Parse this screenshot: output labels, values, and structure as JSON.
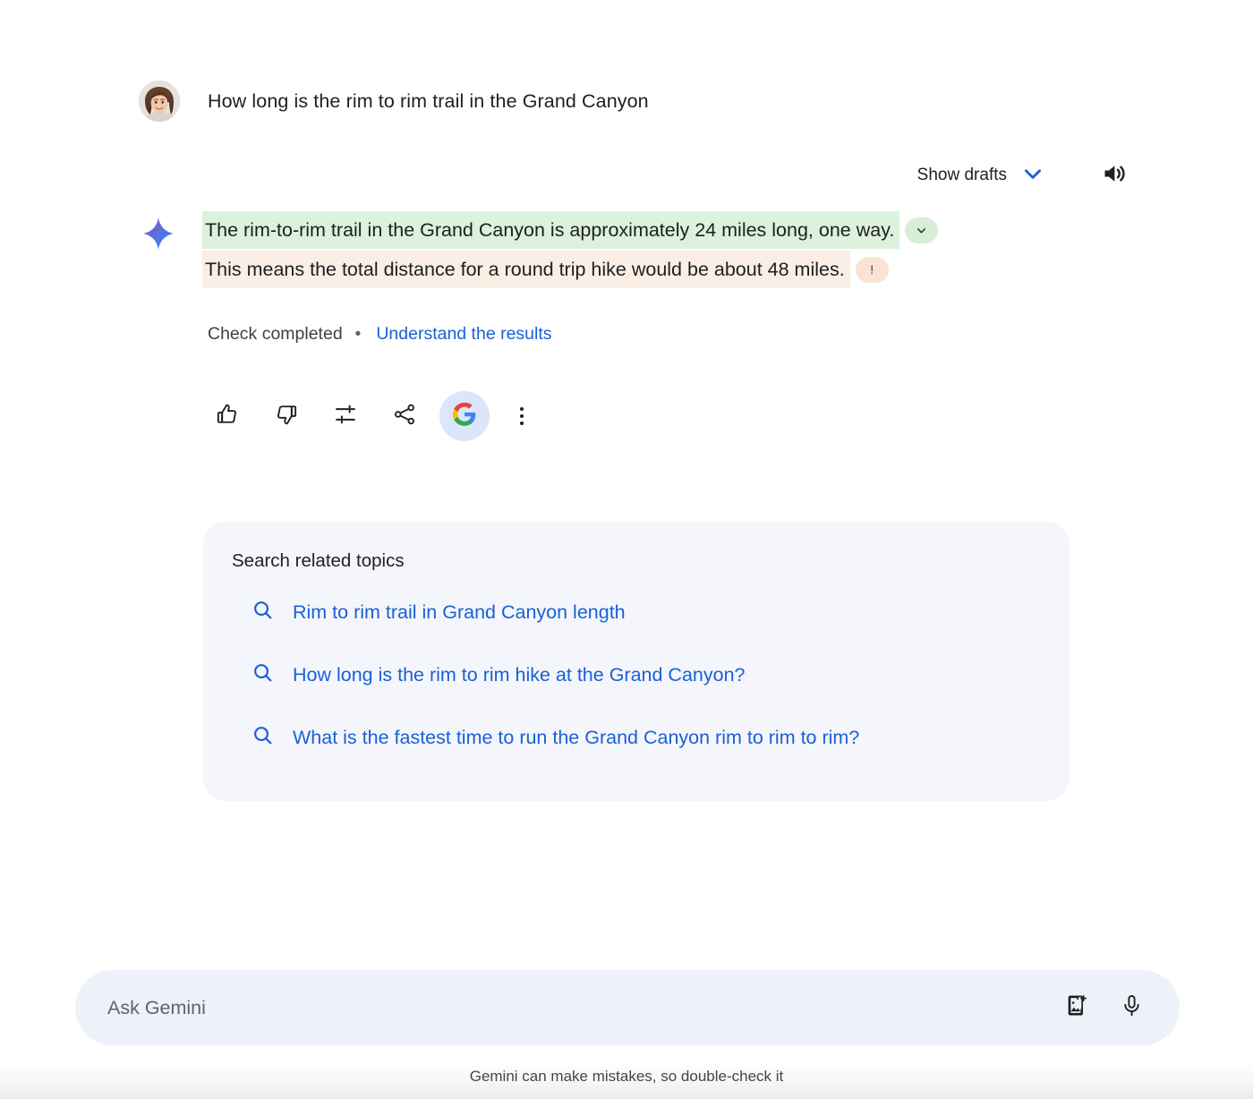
{
  "conversation": {
    "user_prompt": "How long is the rim to rim trail in the Grand Canyon",
    "avatar_alt": "user-avatar"
  },
  "drafts": {
    "show_drafts_label": "Show drafts",
    "chevron_icon": "chevron-down-icon",
    "speaker_icon": "volume-up-icon"
  },
  "response": {
    "model_icon": "gemini-sparkle-icon",
    "claims": [
      {
        "text": "The rim-to-rim trail in the Grand Canyon is approximately 24 miles long, one way.",
        "highlight": "green",
        "badge_icon": "chevron-down-icon",
        "badge_glyph": ""
      },
      {
        "text": "This means the total distance for a round trip hike would be about 48 miles.",
        "highlight": "peach",
        "badge_icon": "exclamation-icon",
        "badge_glyph": "!"
      }
    ]
  },
  "check": {
    "status_label": "Check completed",
    "separator": "•",
    "link_label": "Understand the results"
  },
  "actions": [
    {
      "name": "thumb-up-icon",
      "label": "Good response"
    },
    {
      "name": "thumb-down-icon",
      "label": "Bad response"
    },
    {
      "name": "tune-icon",
      "label": "Modify response"
    },
    {
      "name": "share-icon",
      "label": "Share & export"
    },
    {
      "name": "google-g-icon",
      "label": "Google it",
      "highlighted": true
    },
    {
      "name": "more-vert-icon",
      "label": "More"
    }
  ],
  "related_topics": {
    "title": "Search related topics",
    "items": [
      {
        "icon": "search-icon",
        "label": "Rim to rim trail in Grand Canyon length"
      },
      {
        "icon": "search-icon",
        "label": "How long is the rim to rim hike at the Grand Canyon?"
      },
      {
        "icon": "search-icon",
        "label": "What is the fastest time to run the Grand Canyon rim to rim to rim?"
      }
    ]
  },
  "composer": {
    "placeholder": "Ask Gemini",
    "value": "",
    "image_icon": "add-image-icon",
    "mic_icon": "microphone-icon"
  },
  "footer": {
    "disclaimer": "Gemini can make mistakes, so double-check it"
  },
  "colors": {
    "link_blue": "#1a60d4",
    "highlight_green": "#dcf2dc",
    "highlight_peach": "#fbeee5",
    "card_bg": "#f4f6fc",
    "composer_bg": "#eef1fa",
    "google_highlight": "#dbe6fb"
  }
}
